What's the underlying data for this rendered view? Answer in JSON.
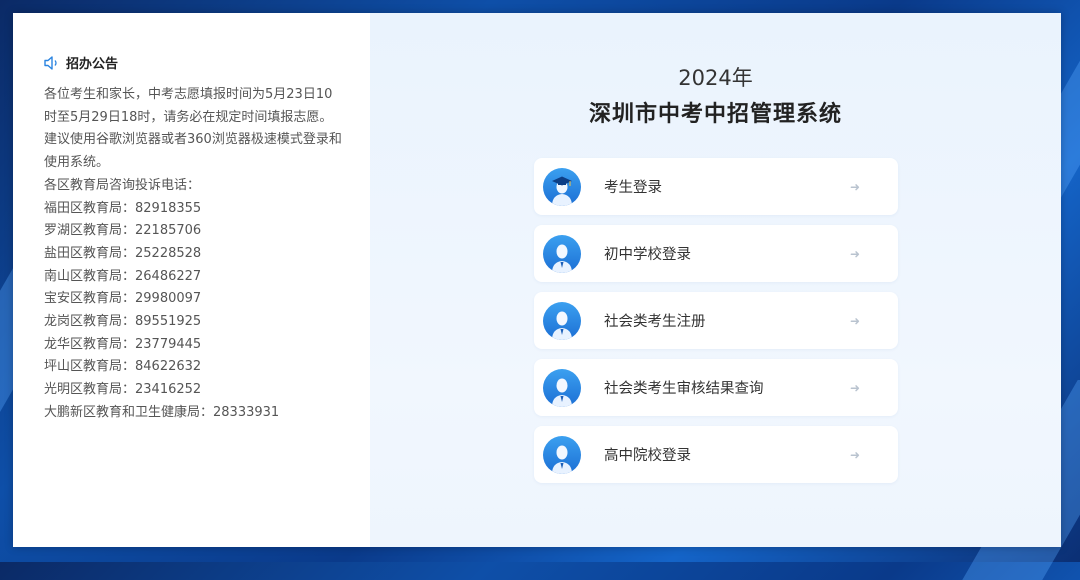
{
  "notice": {
    "title": "招办公告",
    "intro": [
      "各位考生和家长，中考志愿填报时间为5月23日10时至5月29日18时，请务必在规定时间填报志愿。",
      "建议使用谷歌浏览器或者360浏览器极速模式登录和使用系统。",
      "各区教育局咨询投诉电话："
    ],
    "phones": [
      "福田区教育局：82918355",
      "罗湖区教育局：22185706",
      "盐田区教育局：25228528",
      "南山区教育局：26486227",
      "宝安区教育局：29980097",
      "龙岗区教育局：89551925",
      "龙华区教育局：23779445",
      "坪山区教育局：84622632",
      "光明区教育局：23416252",
      "大鹏新区教育和卫生健康局：28333931"
    ]
  },
  "system": {
    "year": "2024年",
    "title": "深圳市中考中招管理系统"
  },
  "login_items": [
    {
      "label": "考生登录",
      "icon": "graduate-avatar-icon"
    },
    {
      "label": "初中学校登录",
      "icon": "person-avatar-icon"
    },
    {
      "label": "社会类考生注册",
      "icon": "person-avatar-icon"
    },
    {
      "label": "社会类考生审核结果查询",
      "icon": "person-avatar-icon"
    },
    {
      "label": "高中院校登录",
      "icon": "person-avatar-icon"
    }
  ],
  "arrow_glyph": "➜",
  "colors": {
    "accent": "#1c6fd4",
    "background_blue": "#0e4fa8",
    "right_panel": "#eaf3fd"
  }
}
